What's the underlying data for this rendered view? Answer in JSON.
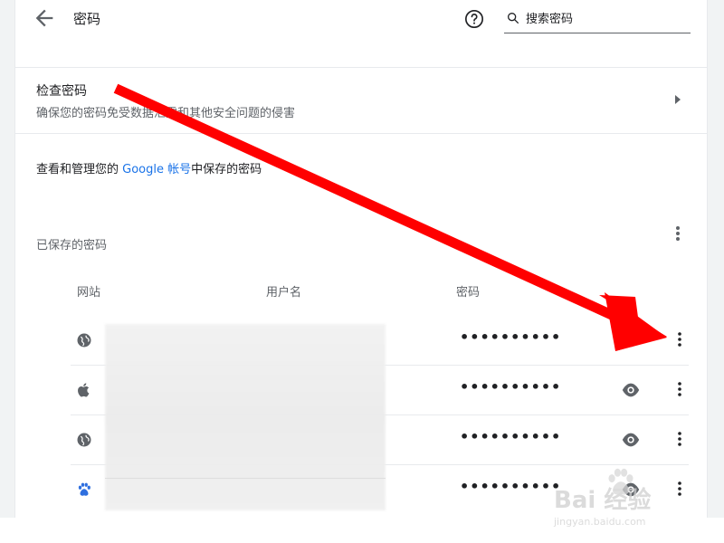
{
  "header": {
    "title": "密码",
    "search_placeholder": "搜索密码"
  },
  "check": {
    "title": "检查密码",
    "subtitle": "确保您的密码免受数据泄露和其他安全问题的侵害"
  },
  "manage": {
    "prefix": "查看和管理您的",
    "link": "Google 帐号",
    "suffix": "中保存的密码"
  },
  "saved": {
    "title": "已保存的密码",
    "columns": [
      "网站",
      "用户名",
      "密码"
    ],
    "rows": [
      {
        "site_icon": "globe-icon",
        "password": "••••••••••"
      },
      {
        "site_icon": "apple-icon",
        "password": "••••••••••"
      },
      {
        "site_icon": "globe-icon",
        "password": "••••••••••"
      },
      {
        "site_icon": "baidu-paw-icon",
        "password": "••••••••••"
      }
    ]
  },
  "watermark": {
    "brand": "Bai 经验",
    "url": "jingyan.baidu.com"
  },
  "colors": {
    "link": "#1a73e8",
    "arrow": "#ff0000",
    "divider": "#e8eaed",
    "muted_text": "#5f6368"
  }
}
